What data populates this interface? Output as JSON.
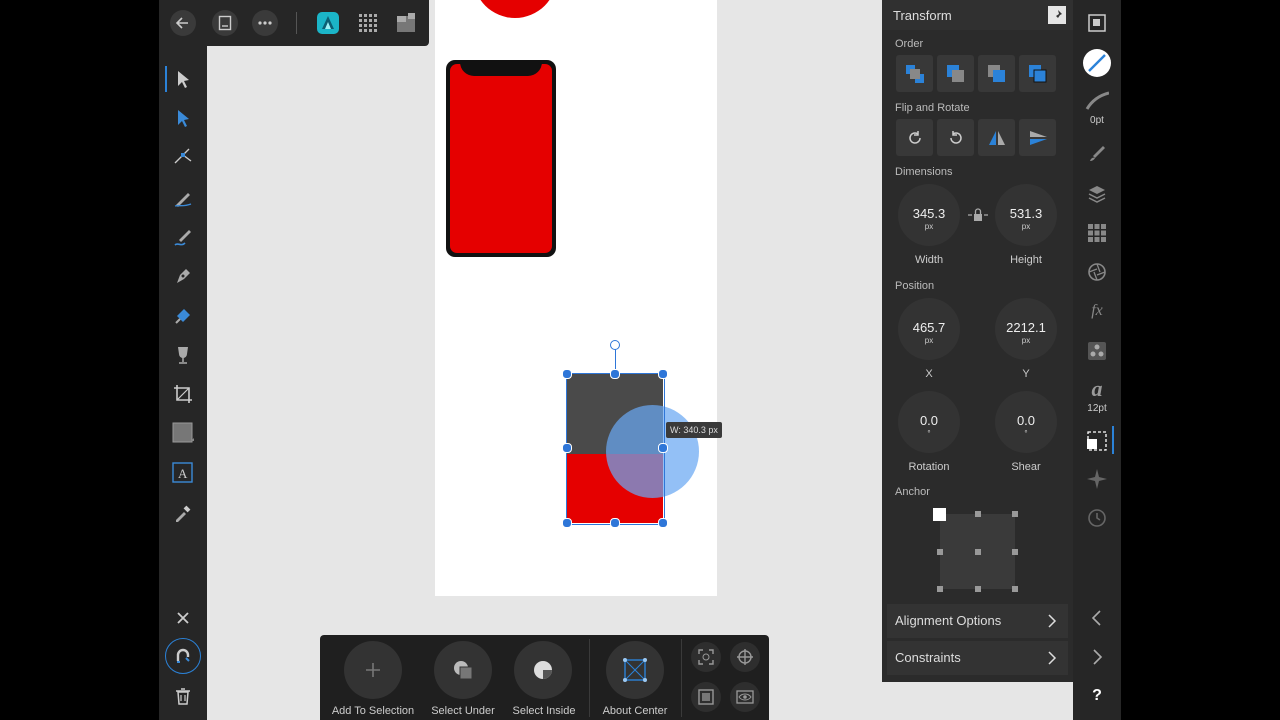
{
  "canvas": {
    "tooltip": "W: 340.3 px"
  },
  "colors": {
    "accent": "#2b82d8",
    "shape_red": "#e50000",
    "shape_gray": "#4a4a4a",
    "circle_blue": "#6aa7f2"
  },
  "top_toolbar": {
    "icons": [
      "back-arrow-icon",
      "document-icon",
      "more-icon",
      "affinity-designer-icon",
      "grid-icon",
      "persona-icon"
    ]
  },
  "transform": {
    "title": "Transform",
    "order_label": "Order",
    "flip_label": "Flip and Rotate",
    "dimensions_label": "Dimensions",
    "width_value": "345.3",
    "height_value": "531.3",
    "unit": "px",
    "width_label": "Width",
    "height_label": "Height",
    "position_label": "Position",
    "x_value": "465.7",
    "y_value": "2212.1",
    "x_label": "X",
    "y_label": "Y",
    "rotation_value": "0.0",
    "shear_value": "0.0",
    "degree": "°",
    "rotation_label": "Rotation",
    "shear_label": "Shear",
    "anchor_label": "Anchor",
    "alignment_options": "Alignment Options",
    "constraints": "Constraints"
  },
  "right_toolbar": {
    "stroke_width": "0pt",
    "font_size": "12pt",
    "fx_label": "fx",
    "text_label": "a",
    "help": "?"
  },
  "context_bar": {
    "add_to_selection": "Add To Selection",
    "select_under": "Select Under",
    "select_inside": "Select Inside",
    "about_center": "About Center"
  }
}
